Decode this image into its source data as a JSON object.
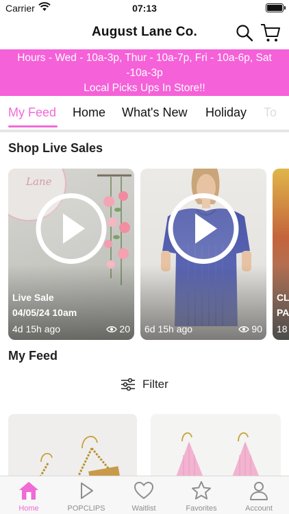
{
  "status_bar": {
    "carrier": "Carrier",
    "time": "07:13"
  },
  "header": {
    "title": "August Lane Co."
  },
  "banner": {
    "line1": "Hours - Wed - 10a-3p, Thur - 10a-7p, Fri - 10a-6p, Sat",
    "line2": "-10a-3p",
    "line3": "Local Picks Ups In Store!!"
  },
  "colors": {
    "accent": "#f06ad6",
    "banner": "#f561d8"
  },
  "tabs": [
    {
      "label": "My Feed",
      "active": true
    },
    {
      "label": "Home"
    },
    {
      "label": "What's New"
    },
    {
      "label": "Holiday"
    },
    {
      "label": "To"
    }
  ],
  "live_sales": {
    "title": "Shop Live Sales",
    "cards": [
      {
        "label_line1": "Live Sale",
        "label_line2": "04/05/24 10am",
        "age": "4d 15h ago",
        "views": "20"
      },
      {
        "age": "6d 15h ago",
        "views": "90"
      },
      {
        "label_line1": "CL",
        "label_line2": "PA",
        "age": "18"
      }
    ]
  },
  "feed": {
    "title": "My Feed",
    "filter_label": "Filter"
  },
  "tab_bar": [
    {
      "label": "Home",
      "icon": "home-icon",
      "active": true
    },
    {
      "label": "POPCLIPS",
      "icon": "play-outline-icon"
    },
    {
      "label": "Waitlist",
      "icon": "heart-icon"
    },
    {
      "label": "Favorites",
      "icon": "star-icon"
    },
    {
      "label": "Account",
      "icon": "person-icon"
    }
  ]
}
